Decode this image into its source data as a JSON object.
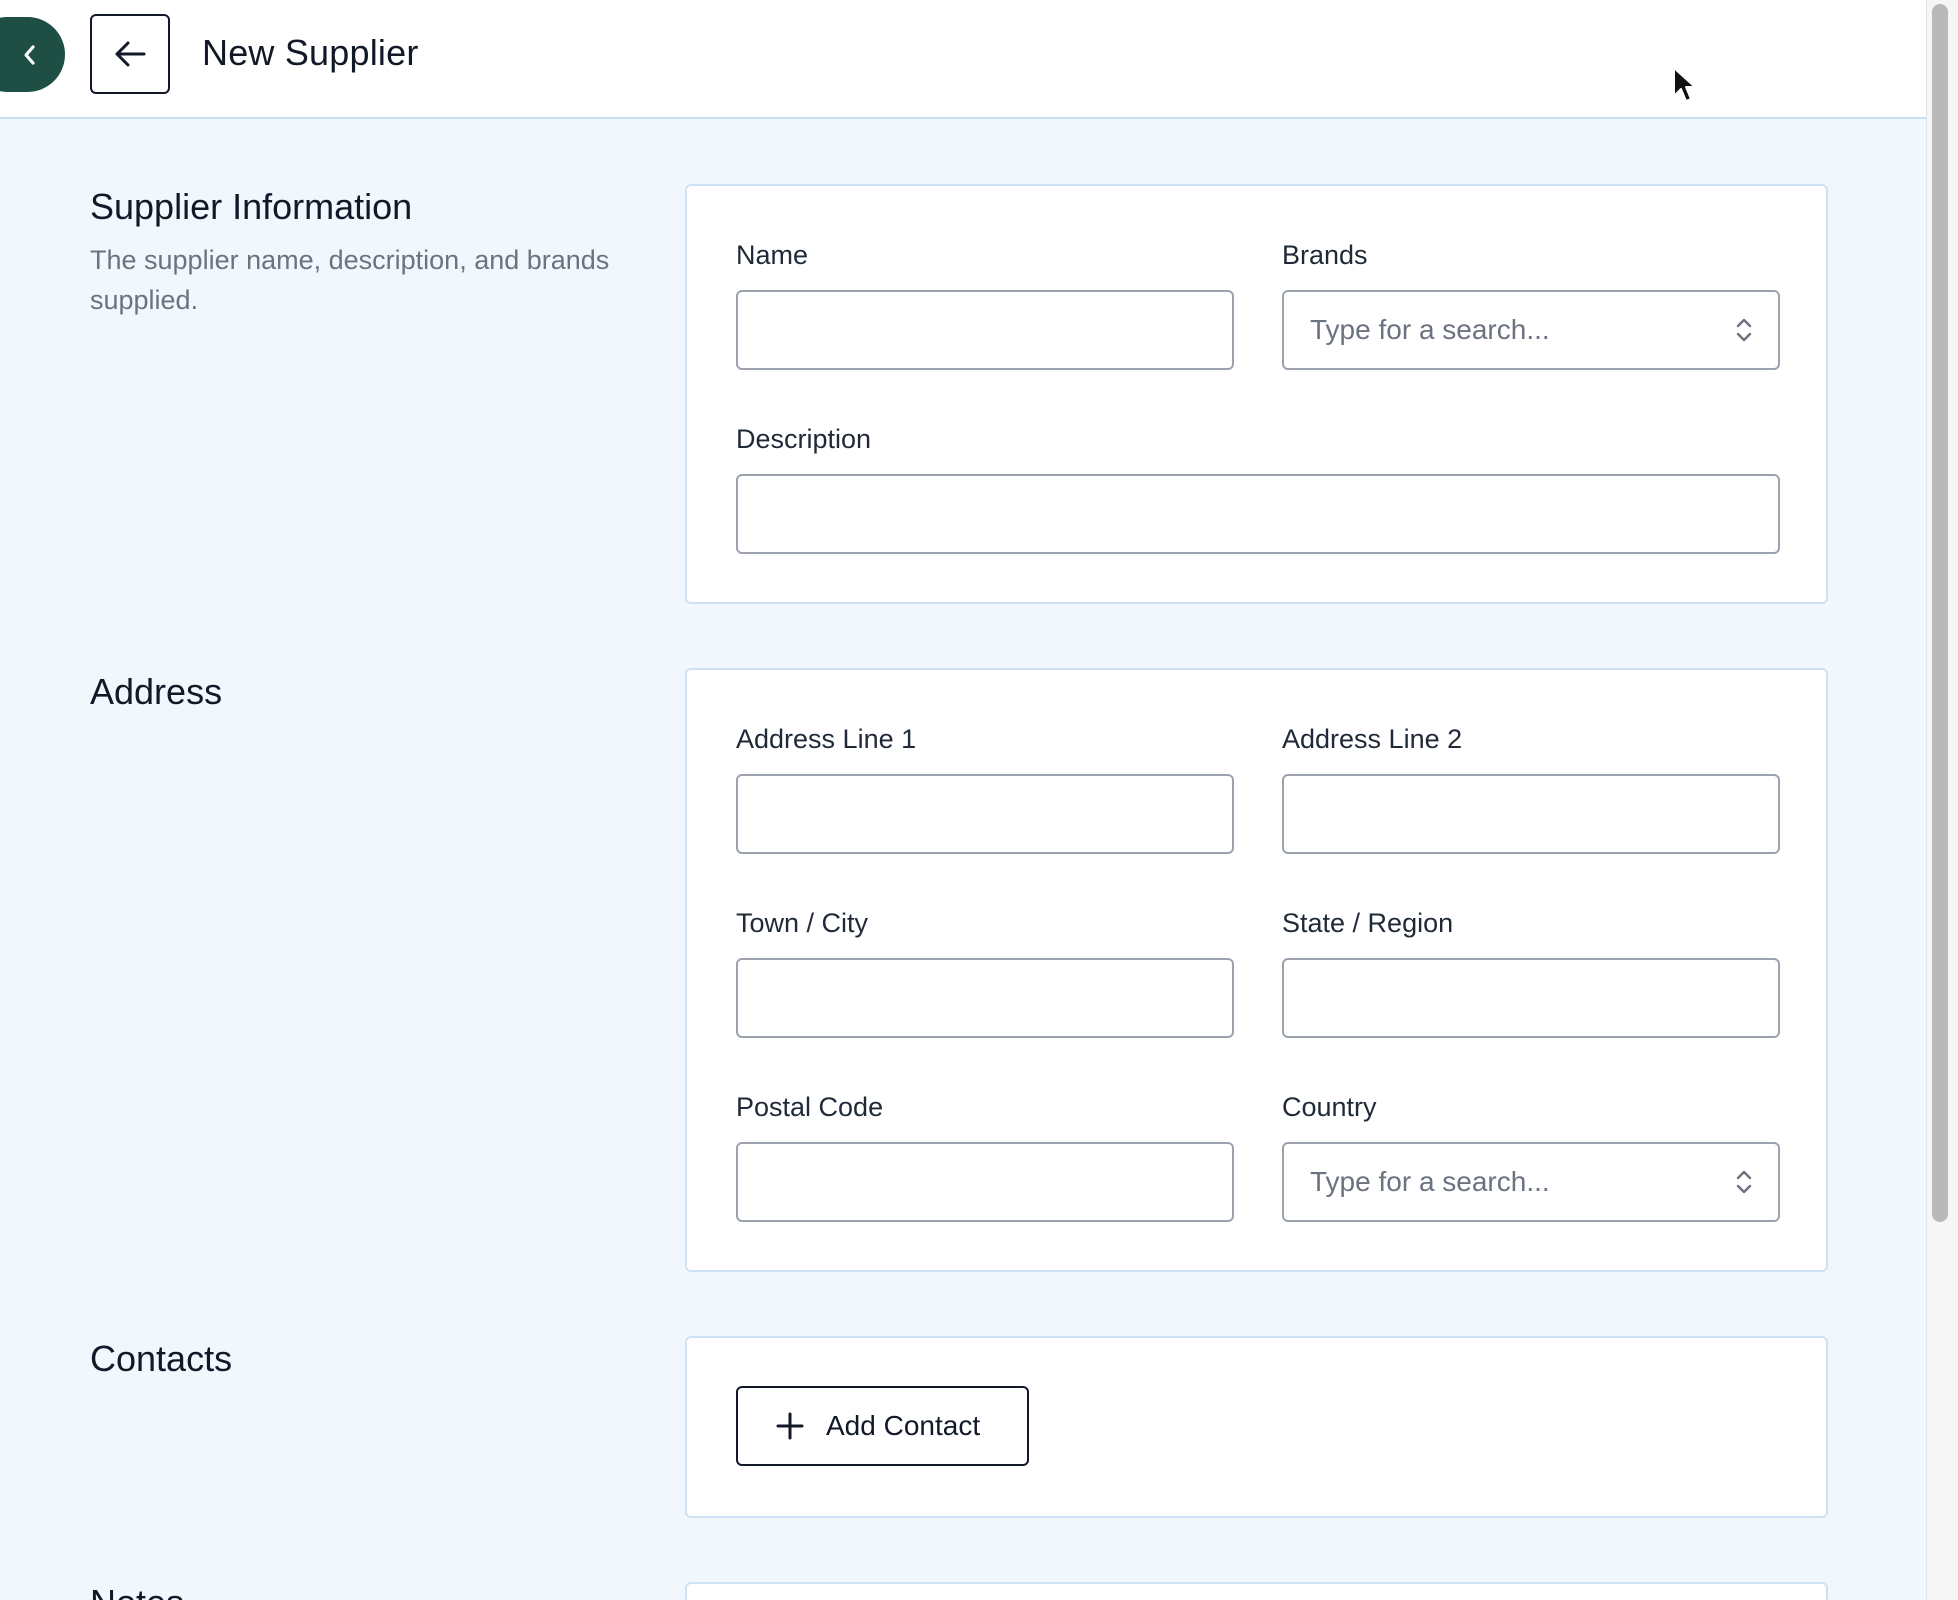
{
  "header": {
    "title": "New Supplier"
  },
  "supplier_information": {
    "title": "Supplier Information",
    "description": "The supplier name, description, and brands supplied.",
    "fields": {
      "name": {
        "label": "Name",
        "value": ""
      },
      "brands": {
        "label": "Brands",
        "placeholder": "Type for a search..."
      },
      "description": {
        "label": "Description",
        "value": ""
      }
    }
  },
  "address": {
    "title": "Address",
    "fields": {
      "line1": {
        "label": "Address Line 1",
        "value": ""
      },
      "line2": {
        "label": "Address Line 2",
        "value": ""
      },
      "city": {
        "label": "Town / City",
        "value": ""
      },
      "state": {
        "label": "State / Region",
        "value": ""
      },
      "postal": {
        "label": "Postal Code",
        "value": ""
      },
      "country": {
        "label": "Country",
        "placeholder": "Type for a search..."
      }
    }
  },
  "contacts": {
    "title": "Contacts",
    "add_button_label": "Add Contact"
  },
  "notes": {
    "title": "Notes"
  },
  "icons": {
    "sidebar_toggle": "chevron-left-icon",
    "back": "arrow-left-icon",
    "add": "plus-icon",
    "select": "chevron-up-down-icon",
    "cursor": "mouse-pointer-icon"
  },
  "colors": {
    "accent": "#1f4f44",
    "page_background": "#f0f7fd",
    "card_border": "#cfe2f3"
  }
}
